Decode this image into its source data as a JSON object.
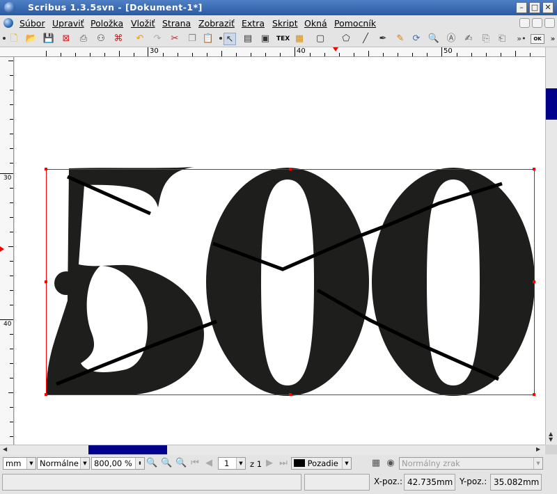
{
  "window": {
    "title": "Scribus 1.3.5svn - [Dokument-1*]"
  },
  "menu": [
    "Súbor",
    "Upraviť",
    "Položka",
    "Vložiť",
    "Strana",
    "Zobraziť",
    "Extra",
    "Skript",
    "Okná",
    "Pomocník"
  ],
  "toolbar": {
    "icons": [
      "new-document-icon",
      "open-icon",
      "save-icon",
      "close-icon",
      "print-icon",
      "preflight-icon",
      "pdf-export-icon",
      "undo-icon",
      "redo-icon",
      "cut-icon",
      "copy-icon",
      "paste-icon",
      "select-icon",
      "text-frame-icon",
      "image-frame-icon",
      "render-frame-icon",
      "table-icon",
      "shape-icon",
      "polygon-icon",
      "line-icon",
      "bezier-icon",
      "freehand-icon",
      "rotate-icon",
      "zoom-icon",
      "edit-content-icon",
      "edit-text-icon",
      "link-frames-icon",
      "unlink-frames-icon",
      "pdf-tools-icon"
    ],
    "tex_label": "TEX",
    "ok_label": "OK"
  },
  "ruler": {
    "h_labels": [
      "30",
      "40",
      "50"
    ],
    "v_labels": [
      "30",
      "40"
    ]
  },
  "canvas": {
    "text": "500",
    "text_color": "#1e1e1c",
    "frame_color": "#ff0000"
  },
  "bottom": {
    "unit": "mm",
    "quality": "Normálne",
    "zoom": "800,00 %",
    "page": "1",
    "page_of": "z 1",
    "layer": "Pozadie",
    "layer_color": "#000000",
    "vision": "Normálny zrak"
  },
  "status": {
    "xpos_label": "X-poz.:",
    "xpos_value": "42.735mm",
    "ypos_label": "Y-poz.:",
    "ypos_value": "35.082mm"
  }
}
